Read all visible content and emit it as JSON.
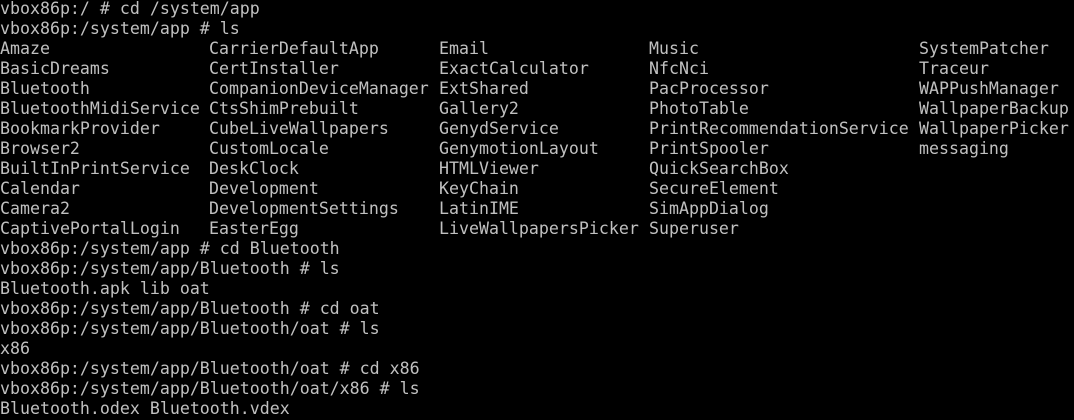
{
  "terminal": {
    "background": "#000000",
    "foreground": "#c0c0c0",
    "lines_before": [
      "vbox86p:/ # cd /system/app",
      "vbox86p:/system/app # ls"
    ],
    "ls_grid": [
      [
        "Amaze",
        "CarrierDefaultApp",
        "Email",
        "Music",
        "SystemPatcher"
      ],
      [
        "BasicDreams",
        "CertInstaller",
        "ExactCalculator",
        "NfcNci",
        "Traceur"
      ],
      [
        "Bluetooth",
        "CompanionDeviceManager",
        "ExtShared",
        "PacProcessor",
        "WAPPushManager"
      ],
      [
        "BluetoothMidiService",
        "CtsShimPrebuilt",
        "Gallery2",
        "PhotoTable",
        "WallpaperBackup"
      ],
      [
        "BookmarkProvider",
        "CubeLiveWallpapers",
        "GenydService",
        "PrintRecommendationService",
        "WallpaperPicker"
      ],
      [
        "Browser2",
        "CustomLocale",
        "GenymotionLayout",
        "PrintSpooler",
        "messaging"
      ],
      [
        "BuiltInPrintService",
        "DeskClock",
        "HTMLViewer",
        "QuickSearchBox",
        ""
      ],
      [
        "Calendar",
        "Development",
        "KeyChain",
        "SecureElement",
        ""
      ],
      [
        "Camera2",
        "DevelopmentSettings",
        "LatinIME",
        "SimAppDialog",
        ""
      ],
      [
        "CaptivePortalLogin",
        "EasterEgg",
        "LiveWallpapersPicker",
        "Superuser",
        ""
      ]
    ],
    "lines_after": [
      "vbox86p:/system/app # cd Bluetooth",
      "vbox86p:/system/app/Bluetooth # ls",
      "Bluetooth.apk lib oat",
      "vbox86p:/system/app/Bluetooth # cd oat",
      "vbox86p:/system/app/Bluetooth/oat # ls",
      "x86",
      "vbox86p:/system/app/Bluetooth/oat # cd x86",
      "vbox86p:/system/app/Bluetooth/oat/x86 # ls",
      "Bluetooth.odex Bluetooth.vdex"
    ]
  }
}
